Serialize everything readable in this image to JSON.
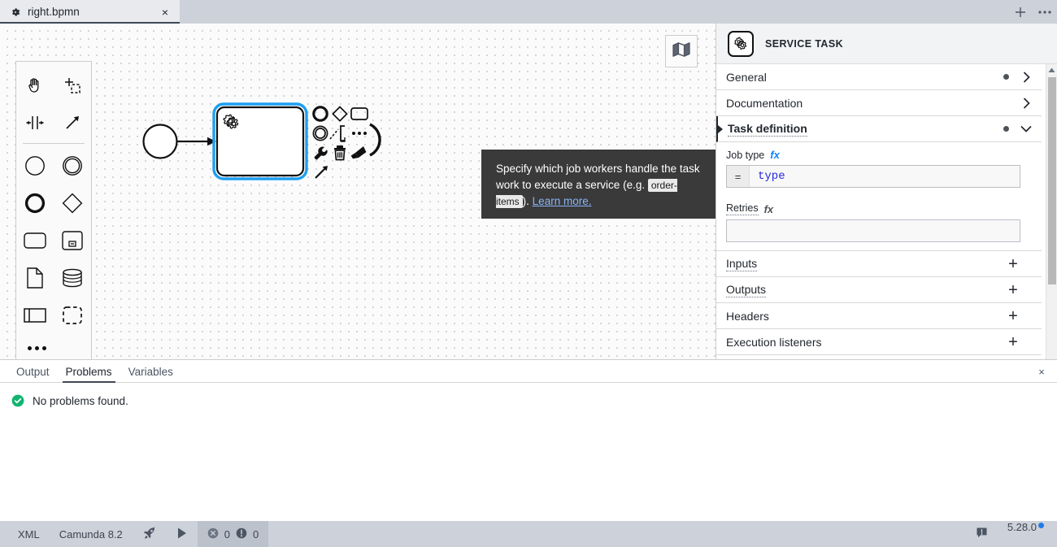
{
  "tabbar": {
    "tabs": [
      {
        "title": "right.bpmn",
        "icon": "gear-icon",
        "close_label": "×",
        "active": true
      }
    ],
    "new_tab_label": "+",
    "overflow_label": "…"
  },
  "canvas": {
    "minimap_button": "minimap-icon",
    "palette": {
      "tools": [
        {
          "name": "hand-tool-icon",
          "label": "Activate the hand tool"
        },
        {
          "name": "lasso-tool-icon",
          "label": "Activate the lasso tool"
        },
        {
          "name": "space-tool-icon",
          "label": "Activate the create/remove space tool"
        },
        {
          "name": "global-connect-tool-icon",
          "label": "Activate the global connect tool"
        }
      ],
      "elements": [
        {
          "name": "create-start-event-icon",
          "label": "Create start event"
        },
        {
          "name": "create-intermediate-event-icon",
          "label": "Create intermediate/boundary event"
        },
        {
          "name": "create-end-event-icon",
          "label": "Create end event"
        },
        {
          "name": "create-gateway-icon",
          "label": "Create gateway"
        },
        {
          "name": "create-task-icon",
          "label": "Create task"
        },
        {
          "name": "create-subprocess-icon",
          "label": "Create expanded subprocess"
        },
        {
          "name": "create-data-object-icon",
          "label": "Create data object reference"
        },
        {
          "name": "create-data-store-icon",
          "label": "Create data store reference"
        },
        {
          "name": "create-participant-icon",
          "label": "Create pool/participant"
        },
        {
          "name": "create-group-icon",
          "label": "Create group"
        }
      ],
      "more_label": "…"
    },
    "diagram": {
      "start_event": {
        "name": "start-event"
      },
      "service_task": {
        "name": "service-task",
        "marker": "gear-icon",
        "selected": true
      },
      "sequence_flow": {
        "name": "sequence-flow"
      },
      "context_pad": [
        {
          "name": "append-end-event-icon"
        },
        {
          "name": "append-gateway-icon"
        },
        {
          "name": "append-task-icon"
        },
        {
          "name": "append-intermediate-event-icon"
        },
        {
          "name": "append-text-annotation-icon"
        },
        {
          "name": "more-options-icon"
        },
        {
          "name": "change-type-arc-icon"
        },
        {
          "name": "wrench-icon"
        },
        {
          "name": "delete-icon"
        },
        {
          "name": "paintbrush-icon"
        },
        {
          "name": "connect-arrow-icon"
        }
      ]
    }
  },
  "tooltip": {
    "text_before": "Specify which job workers handle the task work to execute a service (e.g. ",
    "code": "order-items",
    "text_after": "). ",
    "link": "Learn more."
  },
  "properties": {
    "header": {
      "title": "SERVICE TASK",
      "icon": "service-task-icon"
    },
    "groups": [
      {
        "name": "general",
        "label": "General",
        "has_dot": true,
        "expanded": false,
        "chevron": "›"
      },
      {
        "name": "documentation",
        "label": "Documentation",
        "has_dot": false,
        "expanded": false,
        "chevron": "›"
      },
      {
        "name": "task-definition",
        "label": "Task definition",
        "has_dot": true,
        "expanded": true,
        "chevron": "⌄"
      }
    ],
    "fields": [
      {
        "name": "job-type",
        "label": "Job type",
        "fx": "fx",
        "fx_active": true,
        "prefix": "=",
        "value": "type",
        "placeholder": ""
      },
      {
        "name": "retries",
        "label": "Retries",
        "fx": "fx",
        "fx_active": false,
        "prefix": "",
        "value": "",
        "placeholder": ""
      }
    ],
    "collections": [
      {
        "name": "inputs",
        "label": "Inputs",
        "add_label": "+",
        "dotted": true
      },
      {
        "name": "outputs",
        "label": "Outputs",
        "add_label": "+",
        "dotted": true
      },
      {
        "name": "headers",
        "label": "Headers",
        "add_label": "+",
        "dotted": false
      },
      {
        "name": "execution-listeners",
        "label": "Execution listeners",
        "add_label": "+",
        "dotted": false
      }
    ]
  },
  "bottom_panel": {
    "tabs": [
      {
        "name": "output",
        "label": "Output",
        "active": false
      },
      {
        "name": "problems",
        "label": "Problems",
        "active": true
      },
      {
        "name": "variables",
        "label": "Variables",
        "active": false
      }
    ],
    "close_label": "×",
    "message": "No problems found.",
    "status_icon": "check-circle-icon",
    "status_color": "#15b371"
  },
  "status_bar": {
    "xml_label": "XML",
    "engine_label": "Camunda 8.2",
    "deploy_icon": "rocket-icon",
    "run_icon": "play-icon",
    "error_count": "0",
    "warning_count": "0",
    "notification_icon": "notification-icon",
    "version": "5.28.0",
    "version_dot_color": "#1f7ce8"
  }
}
